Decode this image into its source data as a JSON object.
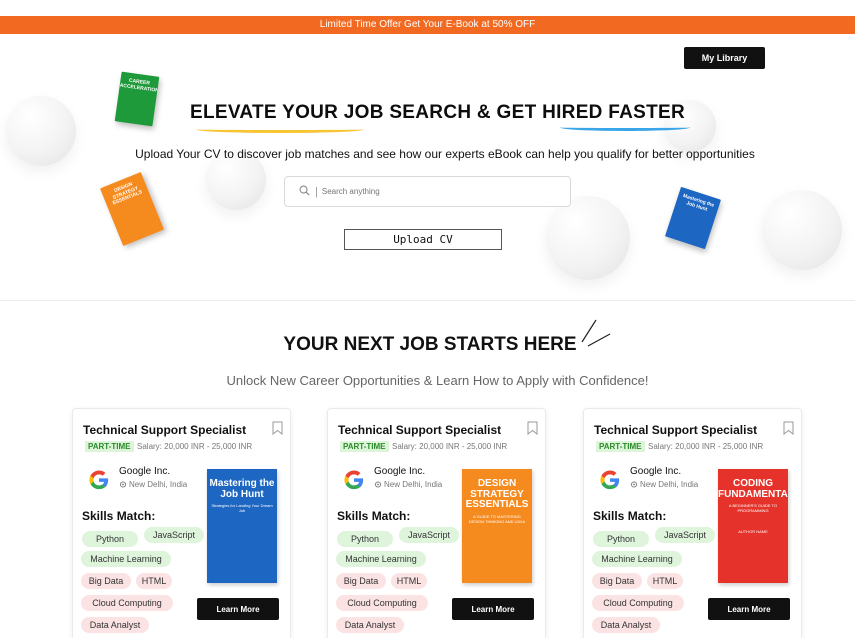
{
  "offer_bar": "Limited Time Offer Get Your E-Book at 50% OFF",
  "header": {
    "library_label": "My Library"
  },
  "hero": {
    "title": "ELEVATE YOUR JOB SEARCH & GET HIRED FASTER",
    "subtitle": "Upload Your CV to discover job matches and see how our experts eBook can help you qualify for better opportunities",
    "search_placeholder": "Search anything",
    "upload_label": "Upload CV",
    "books": [
      {
        "title": "CAREER ACCELERATION",
        "color": "#1e9a3a"
      },
      {
        "title": "DESIGN STRATEGY ESSENTIALS",
        "color": "#f58a1f"
      },
      {
        "title": "Mastering the Job Hunt",
        "color": "#1d66c2"
      }
    ]
  },
  "section": {
    "title": "YOUR NEXT JOB STARTS HERE",
    "subtitle": "Unlock New Career Opportunities & Learn How to Apply with Confidence!"
  },
  "cards": [
    {
      "job_title": "Technical Support Specialist",
      "type": "PART-TIME",
      "salary": "Salary: 20,000 INR - 25,000 INR",
      "company": "Google Inc.",
      "location": "New Delhi, India",
      "skills_title": "Skills Match:",
      "skills": [
        "Python",
        "JavaScript",
        "Machine Learning",
        "Big Data",
        "HTML",
        "Cloud Computing",
        "Data Analyst"
      ],
      "book": {
        "title": "Mastering the Job Hunt",
        "subtitle": "Strategies for Landing Your Dream Job"
      },
      "learn_label": "Learn More"
    },
    {
      "job_title": "Technical Support Specialist",
      "type": "PART-TIME",
      "salary": "Salary: 20,000 INR - 25,000 INR",
      "company": "Google Inc.",
      "location": "New Delhi, India",
      "skills_title": "Skills Match:",
      "skills": [
        "Python",
        "JavaScript",
        "Machine Learning",
        "Big Data",
        "HTML",
        "Cloud Computing",
        "Data Analyst"
      ],
      "book": {
        "title": "DESIGN STRATEGY ESSENTIALS",
        "subtitle": "A GUIDE TO MASTERING DESIGN THINKING AND UX/UI"
      },
      "learn_label": "Learn More"
    },
    {
      "job_title": "Technical Support Specialist",
      "type": "PART-TIME",
      "salary": "Salary: 20,000 INR - 25,000 INR",
      "company": "Google Inc.",
      "location": "New Delhi, India",
      "skills_title": "Skills Match:",
      "skills": [
        "Python",
        "JavaScript",
        "Machine Learning",
        "Big Data",
        "HTML",
        "Cloud Computing",
        "Data Analyst"
      ],
      "book": {
        "title": "CODING FUNDAMENTALS",
        "subtitle": "A BEGINNER'S GUIDE TO PROGRAMMING",
        "author": "AUTHOR NAME"
      },
      "learn_label": "Learn More"
    }
  ],
  "colors": {
    "offer": "#f26a21",
    "accent_yellow": "#f6c531",
    "accent_blue": "#3aa6e8"
  }
}
